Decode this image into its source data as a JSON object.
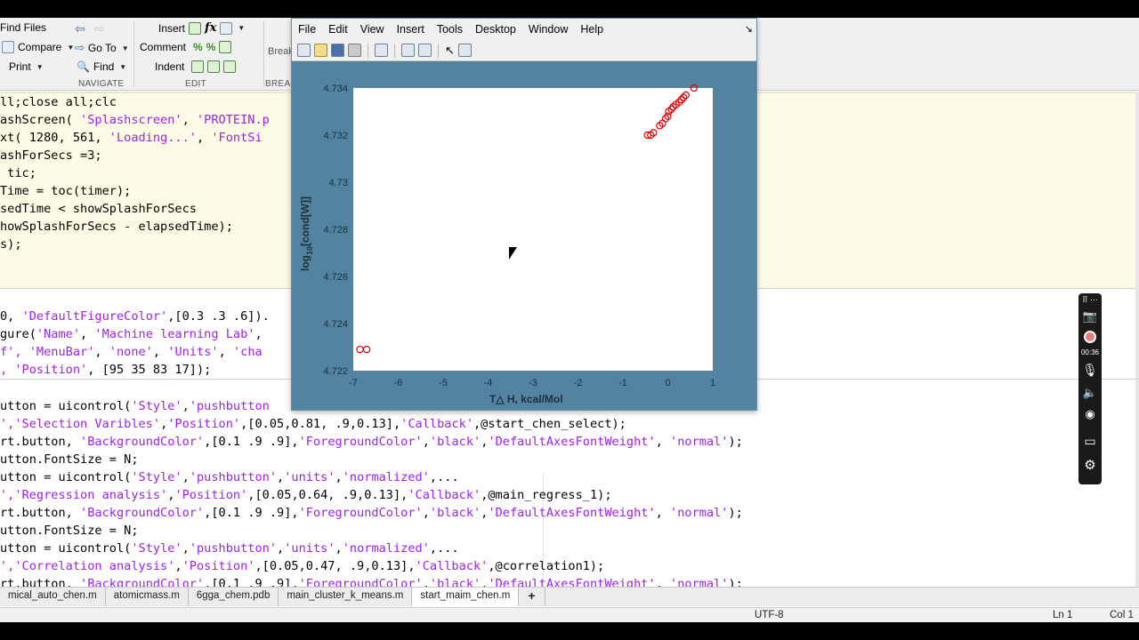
{
  "toolstrip": {
    "find_files": "Find Files",
    "compare": "Compare",
    "print": "Print",
    "go_to": "Go To",
    "find": "Find",
    "navigate_label": "NAVIGATE",
    "insert": "Insert",
    "fx": "fx",
    "comment": "Comment",
    "indent": "Indent",
    "edit_label": "EDIT",
    "breakpoints": "Break",
    "breakpoints_label": "BREAK"
  },
  "code": {
    "l1": "ll;close all;clc",
    "l2a": "ashScreen( ",
    "l2b": "'Splashscreen'",
    "l2c": ", ",
    "l2d": "'PROTEIN.p",
    "l3a": "xt( 1280, 561, ",
    "l3b": "'Loading...'",
    "l3c": ", ",
    "l3d": "'FontSi",
    "l4": "ashForSecs =3;",
    "l5": " tic;",
    "l6": "Time = toc(timer);",
    "l7": "sedTime < showSplashForSecs",
    "l8": "howSplashForSecs - elapsedTime);",
    "l9": "s);",
    "l10a": "0, ",
    "l10b": "'DefaultFigureColor'",
    "l10c": ",[0.3 .3 .6]).",
    "l11a": "gure(",
    "l11b": "'Name'",
    "l11c": ", ",
    "l11d": "'Machine learning Lab'",
    "l11e": ",",
    "l12a": "f', ",
    "l12b": "'MenuBar'",
    "l12c": ", ",
    "l12d": "'none'",
    "l12e": ", ",
    "l12f": "'Units'",
    "l12g": ", ",
    "l12h": "'cha",
    "l13a": ", ",
    "l13b": "'Position'",
    "l13c": ", [95 35 83 17]);",
    "l14a": "utton = uicontrol(",
    "l14b": "'Style'",
    "l14c": ",",
    "l14d": "'pushbutton",
    "l15a": "",
    "l15b": "','Selection Varibles'",
    "l15c": ",",
    "l15d": "'Position'",
    "l15e": ",[0.05,0.81, .9,0.13],",
    "l15f": "'Callback'",
    "l15g": ",@start_chen_select);",
    "l16a": "rt.button, ",
    "l16b": "'BackgroundColor'",
    "l16c": ",[0.1 .9 .9],",
    "l16d": "'ForegroundColor'",
    "l16e": ",",
    "l16f": "'black'",
    "l16g": ",",
    "l16h": "'DefaultAxesFontWeight'",
    "l16i": ", ",
    "l16j": "'normal'",
    "l16k": ");",
    "l17": "utton.FontSize = N;",
    "l18a": "utton = uicontrol(",
    "l18b": "'Style'",
    "l18c": ",",
    "l18d": "'pushbutton'",
    "l18e": ",",
    "l18f": "'units'",
    "l18g": ",",
    "l18h": "'normalized'",
    "l18i": ",...",
    "l19b": "','Regression analysis'",
    "l19c": ",",
    "l19d": "'Position'",
    "l19e": ",[0.05,0.64, .9,0.13],",
    "l19f": "'Callback'",
    "l19g": ",@main_regress_1);",
    "l20a": "rt.button, ",
    "l20b": "'BackgroundColor'",
    "l20c": ",[0.1 .9 .9],",
    "l20d": "'ForegroundColor'",
    "l20e": ",",
    "l20f": "'black'",
    "l20g": ",",
    "l20h": "'DefaultAxesFontWeight'",
    "l20i": ", ",
    "l20j": "'normal'",
    "l20k": ");",
    "l21": "utton.FontSize = N;",
    "l22a": "utton = uicontrol(",
    "l22b": "'Style'",
    "l22c": ",",
    "l22d": "'pushbutton'",
    "l22e": ",",
    "l22f": "'units'",
    "l22g": ",",
    "l22h": "'normalized'",
    "l22i": ",...",
    "l23b": "','Correlation analysis'",
    "l23c": ",",
    "l23d": "'Position'",
    "l23e": ",[0.05,0.47, .9,0.13],",
    "l23f": "'Callback'",
    "l23g": ",@correlation1);",
    "l24a": "rt.button, ",
    "l24b": "'BackgroundColor'",
    "l24c": ",[0.1 .9 .9],",
    "l24d": "'ForegroundColor'",
    "l24e": ",",
    "l24f": "'black'",
    "l24g": ",",
    "l24h": "'DefaultAxesFontWeight'",
    "l24i": ", ",
    "l24j": "'normal'",
    "l24k": ");"
  },
  "tabs": [
    {
      "label": "mical_auto_chen.m"
    },
    {
      "label": "atomicmass.m"
    },
    {
      "label": "6gga_chem.pdb"
    },
    {
      "label": "main_cluster_k_means.m"
    },
    {
      "label": "start_maim_chen.m"
    },
    {
      "label": "+"
    }
  ],
  "status": {
    "encoding": "UTF-8",
    "ln": "Ln  1",
    "col": "Col  1"
  },
  "figure": {
    "menu": [
      "File",
      "Edit",
      "View",
      "Insert",
      "Tools",
      "Desktop",
      "Window",
      "Help"
    ],
    "close_glyph": "↘",
    "bg_color": "#5283a0"
  },
  "recorder": {
    "time": "00:36"
  },
  "chart_data": {
    "type": "scatter",
    "xlabel": "T△ H, kcal/Mol",
    "ylabel": "log10[cond[W]]",
    "ylabel_base": "log",
    "ylabel_sub": "10",
    "ylabel_rest": "[cond[W]]",
    "xlim": [
      -7,
      1
    ],
    "ylim": [
      4.722,
      4.734
    ],
    "xticks": [
      -7,
      -6,
      -5,
      -4,
      -3,
      -2,
      -1,
      0,
      1
    ],
    "yticks": [
      4.722,
      4.724,
      4.726,
      4.728,
      4.73,
      4.732,
      4.734
    ],
    "ytick_labels": [
      "4.722",
      "4.724",
      "4.726",
      "4.728",
      "4.73",
      "4.732",
      "4.734"
    ],
    "marker": "circle-open",
    "color": "#e00000",
    "grid": false,
    "points": [
      [
        -6.85,
        4.7229
      ],
      [
        -6.7,
        4.7229
      ],
      [
        -0.45,
        4.732
      ],
      [
        -0.38,
        4.732
      ],
      [
        -0.32,
        4.7321
      ],
      [
        -0.18,
        4.7324
      ],
      [
        -0.12,
        4.7325
      ],
      [
        -0.05,
        4.7327
      ],
      [
        0.0,
        4.7328
      ],
      [
        0.02,
        4.733
      ],
      [
        0.08,
        4.7331
      ],
      [
        0.12,
        4.7332
      ],
      [
        0.18,
        4.7333
      ],
      [
        0.25,
        4.7334
      ],
      [
        0.3,
        4.7335
      ],
      [
        0.35,
        4.7336
      ],
      [
        0.4,
        4.7337
      ],
      [
        0.58,
        4.734
      ]
    ]
  }
}
